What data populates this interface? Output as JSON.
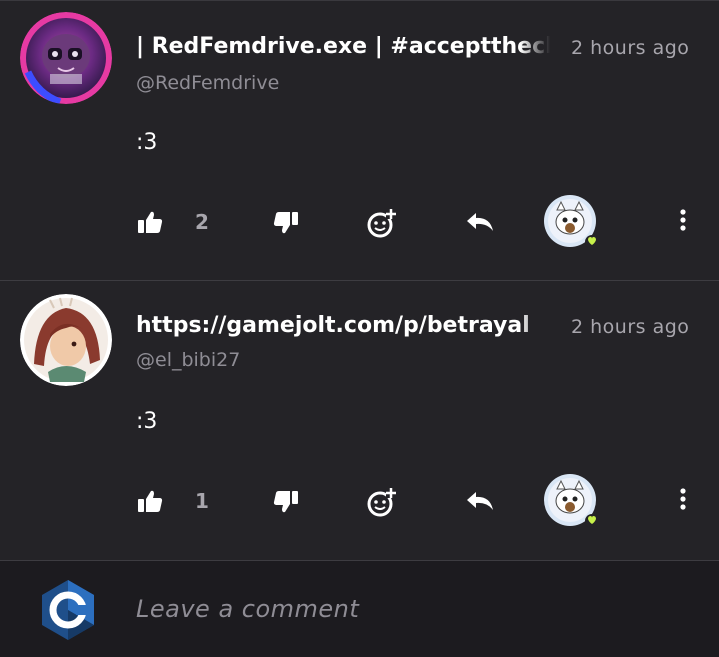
{
  "comments": [
    {
      "display_name": "| RedFemdrive.exe | #acceptthech",
      "handle": "@RedFemdrive",
      "time": "2 hours ago",
      "text": ":3",
      "likes": "2"
    },
    {
      "display_name": "https://gamejolt.com/p/betrayal",
      "handle": "@el_bibi27",
      "time": "2 hours ago",
      "text": ":3",
      "likes": "1"
    }
  ],
  "composer": {
    "placeholder": "Leave a comment"
  },
  "colors": {
    "background": "#242327",
    "secondary_text": "#a8a6ad",
    "online_badge": "#c6f04a"
  },
  "icons": [
    "like-icon",
    "dislike-icon",
    "add-reaction-icon",
    "reply-icon",
    "more-options-icon",
    "c-logo-icon"
  ]
}
